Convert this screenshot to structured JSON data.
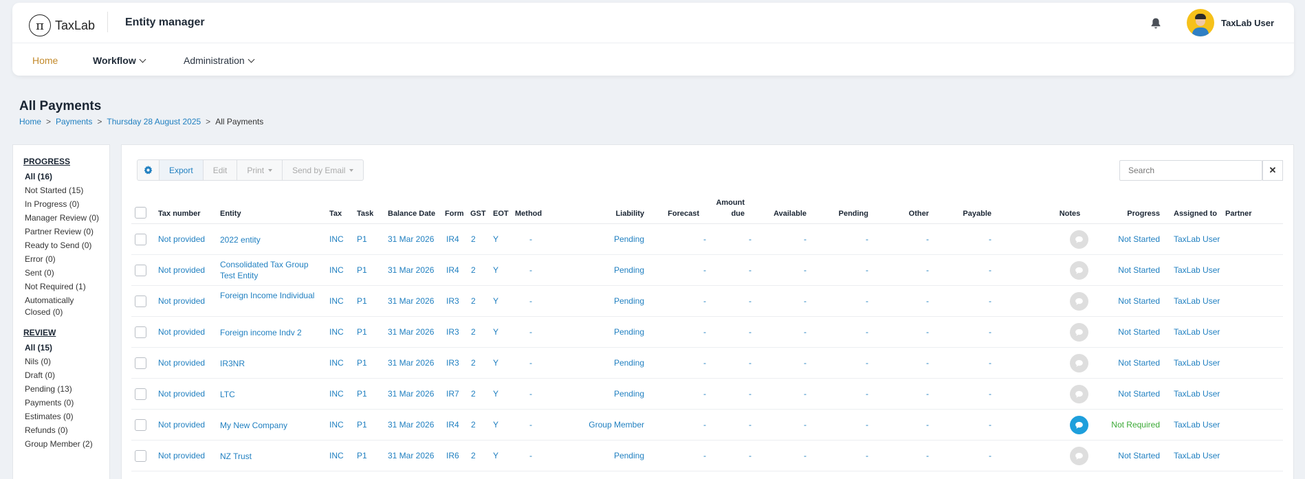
{
  "header": {
    "logo_symbol": "π",
    "logo_text": "TaxLab",
    "app_title": "Entity manager",
    "user_name": "TaxLab User",
    "nav": [
      {
        "label": "Home"
      },
      {
        "label": "Workflow"
      },
      {
        "label": "Administration"
      }
    ]
  },
  "page": {
    "title": "All Payments",
    "breadcrumb": [
      "Home",
      "Payments",
      "Thursday 28 August 2025",
      "All Payments"
    ],
    "breadcrumb_sep": ">"
  },
  "sidebar": {
    "progress_heading": "PROGRESS",
    "progress": [
      "All (16)",
      "Not Started (15)",
      "In Progress (0)",
      "Manager Review (0)",
      "Partner Review (0)",
      "Ready to Send (0)",
      "Error (0)",
      "Sent (0)",
      "Not Required (1)",
      "Automatically Closed (0)"
    ],
    "review_heading": "REVIEW",
    "review": [
      "All (15)",
      "Nils (0)",
      "Draft (0)",
      "Pending (13)",
      "Payments (0)",
      "Estimates (0)",
      "Refunds (0)",
      "Group Member (2)"
    ]
  },
  "toolbar": {
    "export": "Export",
    "edit": "Edit",
    "print": "Print",
    "send_email": "Send by Email",
    "search_placeholder": "Search",
    "clear": "✕"
  },
  "table": {
    "columns": {
      "tax_number": "Tax number",
      "entity": "Entity",
      "tax": "Tax",
      "task": "Task",
      "balance_date": "Balance Date",
      "form": "Form",
      "gst": "GST",
      "eot": "EOT",
      "method": "Method",
      "liability": "Liability",
      "forecast": "Forecast",
      "amount_due_1": "Amount",
      "amount_due_2": "due",
      "available": "Available",
      "pending": "Pending",
      "other": "Other",
      "payable": "Payable",
      "notes": "Notes",
      "progress": "Progress",
      "assigned_to": "Assigned to",
      "partner": "Partner"
    },
    "rows": [
      {
        "tax_number": "Not provided",
        "entity": "2022 entity",
        "tax": "INC",
        "task": "P1",
        "balance_date": "31 Mar 2026",
        "form": "IR4",
        "gst": "2",
        "eot": "Y",
        "method": "-",
        "liability": "Pending",
        "forecast": "-",
        "amount_due": "-",
        "available": "-",
        "pending": "-",
        "other": "-",
        "payable": "-",
        "progress": "Not Started",
        "assigned_to": "TaxLab User",
        "partner": ""
      },
      {
        "tax_number": "Not provided",
        "entity": "Consolidated Tax Group Test Entity",
        "tax": "INC",
        "task": "P1",
        "balance_date": "31 Mar 2026",
        "form": "IR4",
        "gst": "2",
        "eot": "Y",
        "method": "-",
        "liability": "Pending",
        "forecast": "-",
        "amount_due": "-",
        "available": "-",
        "pending": "-",
        "other": "-",
        "payable": "-",
        "progress": "Not Started",
        "assigned_to": "TaxLab User",
        "partner": ""
      },
      {
        "tax_number": "Not provided",
        "entity": "Foreign Income Individual",
        "tax": "INC",
        "task": "P1",
        "balance_date": "31 Mar 2026",
        "form": "IR3",
        "gst": "2",
        "eot": "Y",
        "method": "-",
        "liability": "Pending",
        "forecast": "-",
        "amount_due": "-",
        "available": "-",
        "pending": "-",
        "other": "-",
        "payable": "-",
        "progress": "Not Started",
        "assigned_to": "TaxLab User",
        "partner": ""
      },
      {
        "tax_number": "Not provided",
        "entity": "Foreign income Indv 2",
        "tax": "INC",
        "task": "P1",
        "balance_date": "31 Mar 2026",
        "form": "IR3",
        "gst": "2",
        "eot": "Y",
        "method": "-",
        "liability": "Pending",
        "forecast": "-",
        "amount_due": "-",
        "available": "-",
        "pending": "-",
        "other": "-",
        "payable": "-",
        "progress": "Not Started",
        "assigned_to": "TaxLab User",
        "partner": ""
      },
      {
        "tax_number": "Not provided",
        "entity": "IR3NR",
        "tax": "INC",
        "task": "P1",
        "balance_date": "31 Mar 2026",
        "form": "IR3",
        "gst": "2",
        "eot": "Y",
        "method": "-",
        "liability": "Pending",
        "forecast": "-",
        "amount_due": "-",
        "available": "-",
        "pending": "-",
        "other": "-",
        "payable": "-",
        "progress": "Not Started",
        "assigned_to": "TaxLab User",
        "partner": ""
      },
      {
        "tax_number": "Not provided",
        "entity": "LTC",
        "tax": "INC",
        "task": "P1",
        "balance_date": "31 Mar 2026",
        "form": "IR7",
        "gst": "2",
        "eot": "Y",
        "method": "-",
        "liability": "Pending",
        "forecast": "-",
        "amount_due": "-",
        "available": "-",
        "pending": "-",
        "other": "-",
        "payable": "-",
        "progress": "Not Started",
        "assigned_to": "TaxLab User",
        "partner": ""
      },
      {
        "tax_number": "Not provided",
        "entity": "My New Company",
        "tax": "INC",
        "task": "P1",
        "balance_date": "31 Mar 2026",
        "form": "IR4",
        "gst": "2",
        "eot": "Y",
        "method": "-",
        "liability": "Group Member",
        "forecast": "-",
        "amount_due": "-",
        "available": "-",
        "pending": "-",
        "other": "-",
        "payable": "-",
        "progress": "Not Required",
        "assigned_to": "TaxLab User",
        "partner": "",
        "note_active": true
      },
      {
        "tax_number": "Not provided",
        "entity": "NZ Trust",
        "tax": "INC",
        "task": "P1",
        "balance_date": "31 Mar 2026",
        "form": "IR6",
        "gst": "2",
        "eot": "Y",
        "method": "-",
        "liability": "Pending",
        "forecast": "-",
        "amount_due": "-",
        "available": "-",
        "pending": "-",
        "other": "-",
        "payable": "-",
        "progress": "Not Started",
        "assigned_to": "TaxLab User",
        "partner": ""
      }
    ]
  },
  "colors": {
    "link": "#1f7fc0",
    "accent_home": "#c38a2b",
    "not_required": "#3aa935",
    "note_active": "#1e9fdc"
  }
}
